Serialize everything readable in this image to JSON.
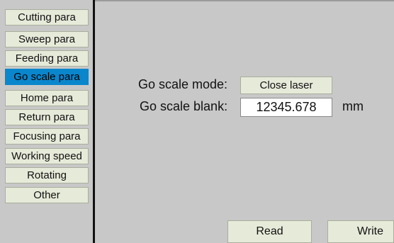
{
  "sidebar": {
    "items": [
      {
        "label": "Cutting para",
        "active": false
      },
      {
        "label": "Sweep para",
        "active": false
      },
      {
        "label": "Feeding para",
        "active": false
      },
      {
        "label": "Go scale para",
        "active": true
      },
      {
        "label": "Home para",
        "active": false
      },
      {
        "label": "Return para",
        "active": false
      },
      {
        "label": "Focusing para",
        "active": false
      },
      {
        "label": "Working speed",
        "active": false
      },
      {
        "label": "Rotating",
        "active": false
      },
      {
        "label": "Other",
        "active": false
      }
    ]
  },
  "main": {
    "mode_label": "Go scale mode:",
    "mode_value": "Close laser",
    "blank_label": "Go scale blank:",
    "blank_value": "12345.678",
    "blank_unit": "mm"
  },
  "footer": {
    "read_label": "Read",
    "write_label": "Write"
  },
  "colors": {
    "background": "#c8c8c8",
    "button": "#e6ead9",
    "active": "#0a86cc",
    "divider": "#111111"
  }
}
